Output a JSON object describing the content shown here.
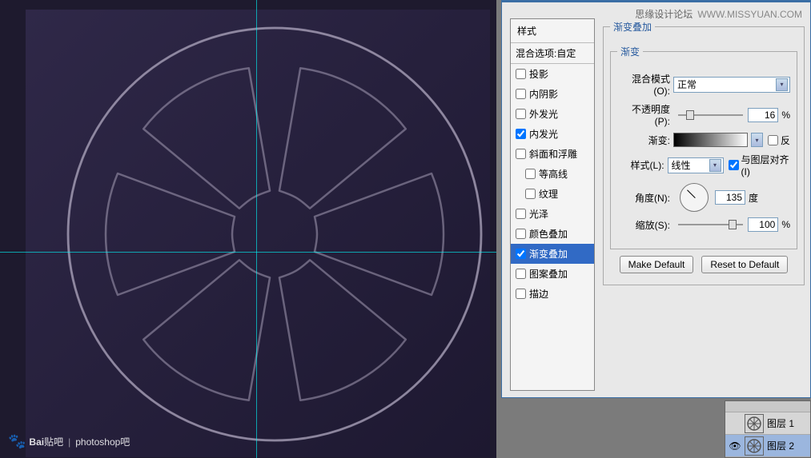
{
  "header": {
    "forum": "思缘设计论坛",
    "url": "WWW.MISSYUAN.COM"
  },
  "styles_panel": {
    "title": "样式",
    "blend_options": "混合选项:自定",
    "items": [
      {
        "label": "投影",
        "checked": false,
        "selected": false
      },
      {
        "label": "内阴影",
        "checked": false,
        "selected": false
      },
      {
        "label": "外发光",
        "checked": false,
        "selected": false
      },
      {
        "label": "内发光",
        "checked": true,
        "selected": false
      },
      {
        "label": "斜面和浮雕",
        "checked": false,
        "selected": false
      },
      {
        "label": "等高线",
        "checked": false,
        "selected": false,
        "sub": true
      },
      {
        "label": "纹理",
        "checked": false,
        "selected": false,
        "sub": true
      },
      {
        "label": "光泽",
        "checked": false,
        "selected": false
      },
      {
        "label": "颜色叠加",
        "checked": false,
        "selected": false
      },
      {
        "label": "渐变叠加",
        "checked": true,
        "selected": true
      },
      {
        "label": "图案叠加",
        "checked": false,
        "selected": false
      },
      {
        "label": "描边",
        "checked": false,
        "selected": false
      }
    ]
  },
  "gradient_overlay": {
    "title": "渐变叠加",
    "gradient_group": "渐变",
    "blend_mode_label": "混合模式(O):",
    "blend_mode_value": "正常",
    "opacity_label": "不透明度(P):",
    "opacity_value": "16",
    "opacity_unit": "%",
    "gradient_label": "渐变:",
    "reverse_label": "反",
    "style_label": "样式(L):",
    "style_value": "线性",
    "align_label": "与图层对齐(I)",
    "angle_label": "角度(N):",
    "angle_value": "135",
    "angle_unit": "度",
    "scale_label": "缩放(S):",
    "scale_value": "100",
    "scale_unit": "%",
    "make_default": "Make Default",
    "reset_default": "Reset to Default"
  },
  "layers": {
    "rows": [
      {
        "name": "图层 1",
        "visible": false
      },
      {
        "name": "图层 2",
        "visible": true
      }
    ]
  },
  "watermark": {
    "brand": "Bai",
    "brand2": "贴吧",
    "section": "photoshop吧"
  }
}
